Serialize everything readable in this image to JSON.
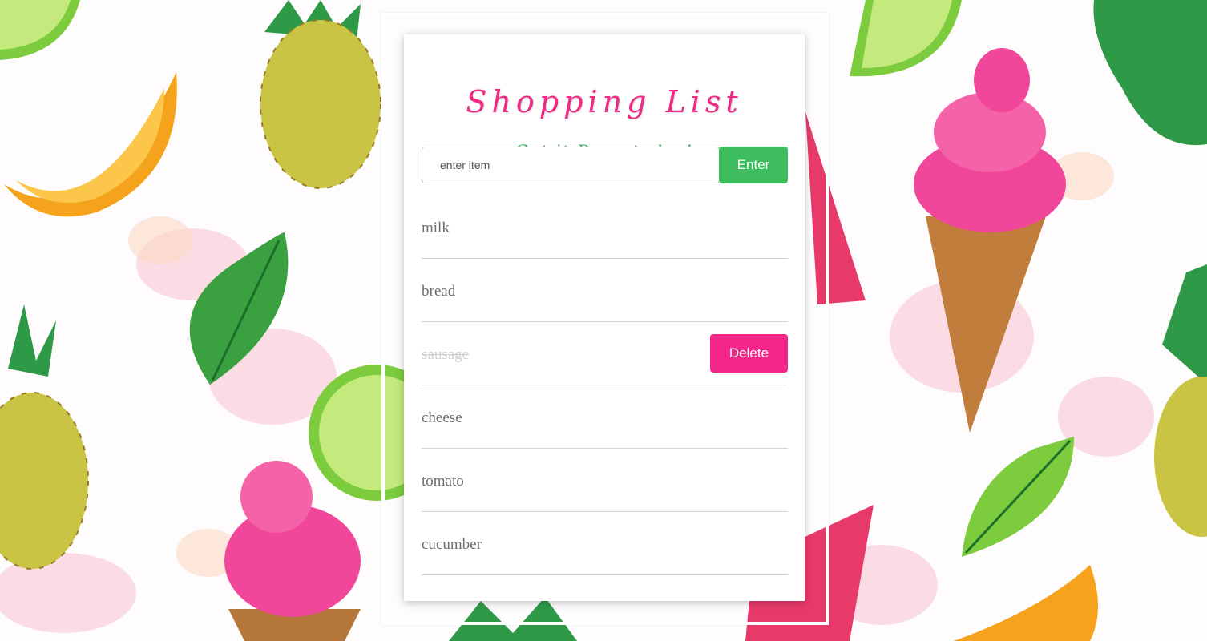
{
  "header": {
    "title": "Shopping List",
    "subtitle": "Get it Done today!"
  },
  "form": {
    "input_placeholder": "enter item",
    "input_value": "",
    "enter_label": "Enter"
  },
  "items": [
    {
      "label": "milk",
      "done": false
    },
    {
      "label": "bread",
      "done": false
    },
    {
      "label": "sausage",
      "done": true,
      "delete_label": "Delete"
    },
    {
      "label": "cheese",
      "done": false
    },
    {
      "label": "tomato",
      "done": false
    },
    {
      "label": "cucumber",
      "done": false
    }
  ],
  "colors": {
    "title": "#ee2a85",
    "subtitle": "#46b15a",
    "enter_button": "#3dbd5d",
    "delete_button": "#f5268a",
    "item_text": "#6b6b6b",
    "done_text": "#cfcfcf"
  },
  "background_icons": [
    "orange-slice-icon",
    "pineapple-icon",
    "leaf-icon",
    "lime-slice-icon",
    "ice-cream-icon",
    "watermelon-slice-icon",
    "monstera-leaf-icon"
  ]
}
